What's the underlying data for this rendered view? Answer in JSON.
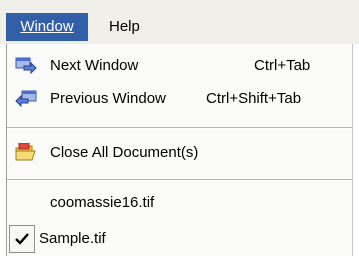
{
  "menubar": {
    "window_label": "Window",
    "help_label": "Help"
  },
  "menu": {
    "items": [
      {
        "label": "Next Window",
        "shortcut": "Ctrl+Tab",
        "icon": "next-window-icon"
      },
      {
        "label": "Previous Window",
        "shortcut": "Ctrl+Shift+Tab",
        "icon": "previous-window-icon"
      },
      {
        "label": "Close All Document(s)",
        "icon": "folder-icon"
      },
      {
        "label": "coomassie16.tif"
      },
      {
        "label": "Sample.tif",
        "checked": true
      }
    ]
  },
  "colors": {
    "menubar_bg": "#f1efe9",
    "active_bg": "#335ea8",
    "menu_bg": "#fbfbf9"
  }
}
